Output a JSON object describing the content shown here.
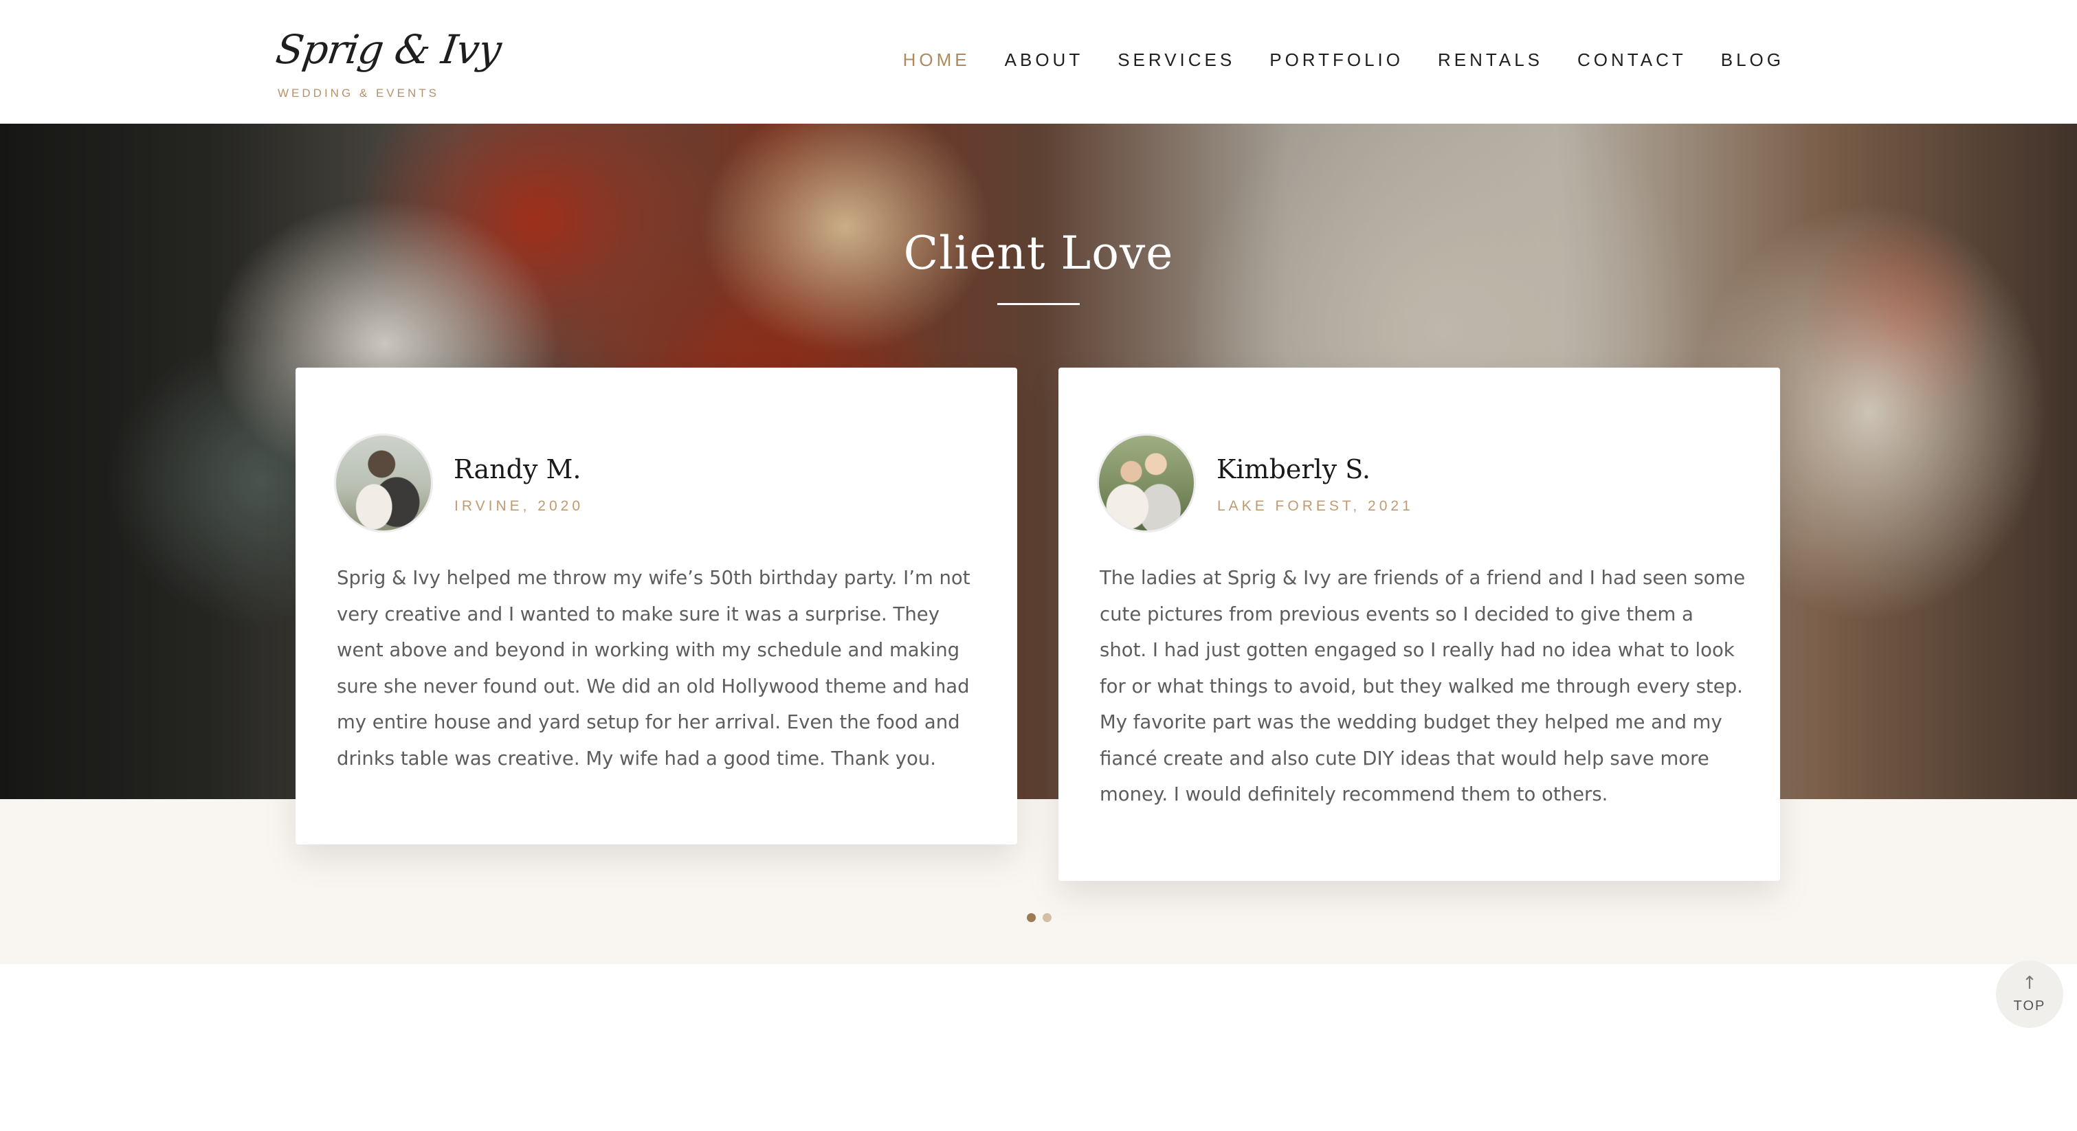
{
  "brand": {
    "name": "Sprig & Ivy",
    "tagline": "WEDDING & EVENTS"
  },
  "nav": {
    "items": [
      {
        "label": "HOME",
        "active": true
      },
      {
        "label": "ABOUT",
        "active": false
      },
      {
        "label": "SERVICES",
        "active": false
      },
      {
        "label": "PORTFOLIO",
        "active": false
      },
      {
        "label": "RENTALS",
        "active": false
      },
      {
        "label": "CONTACT",
        "active": false
      },
      {
        "label": "BLOG",
        "active": false
      }
    ]
  },
  "section": {
    "title": "Client Love"
  },
  "testimonials": [
    {
      "name": "Randy M.",
      "meta": "IRVINE, 2020",
      "quote": "Sprig & Ivy helped me throw my wife’s 50th birthday party. I’m not very creative and I wanted to make sure it was a surprise. They went above and beyond in working with my schedule and making sure she never found out. We did an old Hollywood theme and had my entire house and yard setup for her arrival. Even the food and drinks table was creative. My wife had a good time. Thank you."
    },
    {
      "name": "Kimberly S.",
      "meta": "LAKE FOREST, 2021",
      "quote": "The ladies at Sprig & Ivy are friends of a friend and I had seen some cute pictures from previous events so I decided to give them a shot. I had just gotten engaged so I really had no idea what to look for or what things to avoid, but they walked me through every step. My favorite part was the wedding budget they helped me and my fiancé create and also cute DIY ideas that would help save more money. I would definitely recommend them to others."
    }
  ],
  "carousel": {
    "active_index": 0,
    "total": 2
  },
  "back_to_top": {
    "label": "TOP",
    "icon": "arrow-up-icon"
  },
  "colors": {
    "accent": "#b08a5d",
    "meta": "#c29a72",
    "cream": "#f9f5f1",
    "text": "#5d5d5d"
  }
}
